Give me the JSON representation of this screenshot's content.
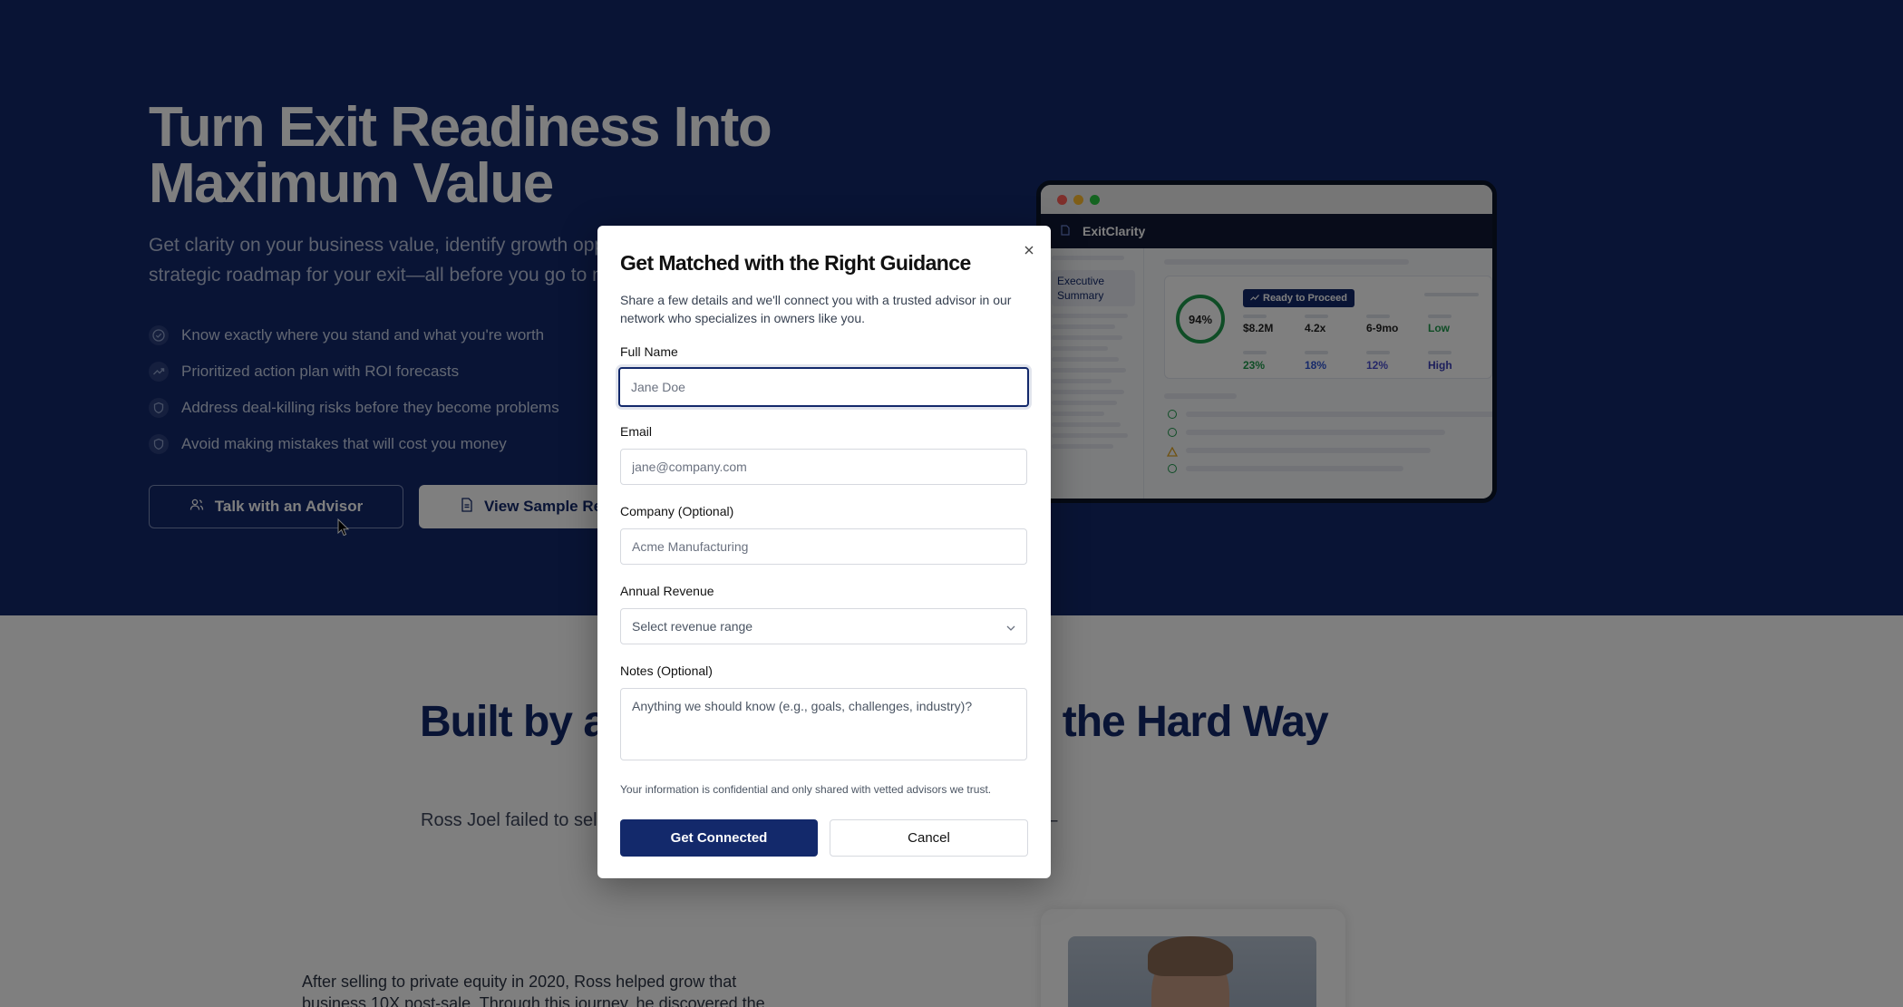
{
  "hero": {
    "title": "Turn Exit Readiness Into Maximum Value",
    "subtitle": "Get clarity on your business value, identify growth opportunities, and get a strategic roadmap for your exit—all before you go to market.",
    "bullets": [
      {
        "icon": "check-circle-icon",
        "text": "Know exactly where you stand and what you're worth"
      },
      {
        "icon": "trending-up-icon",
        "text": "Prioritized action plan with ROI forecasts"
      },
      {
        "icon": "shield-icon",
        "text": "Address deal-killing risks before they become problems"
      },
      {
        "icon": "shield-icon",
        "text": "Avoid making mistakes that will cost you money"
      }
    ],
    "advisor_button": "Talk with an Advisor",
    "sample_button": "View Sample Report"
  },
  "mock_app": {
    "app_name": "ExitClarity",
    "sidebar_active": "Executive Summary",
    "score": "94%",
    "badge": "Ready to Proceed",
    "metrics": {
      "value": "$8.2M",
      "multiple": "4.2x",
      "timeline": "6-9mo",
      "risk": "Low",
      "stat1": "23%",
      "stat2": "18%",
      "stat3": "12%",
      "priority": "High"
    }
  },
  "lower": {
    "title": "Built by an Owner Who Learned the Hard Way",
    "para": "Ross Joel failed to sell his business twice. He learned what derailed his exits —",
    "story": "After selling to private equity in 2020, Ross helped grow that business 10X post-sale. Through this journey, he discovered the"
  },
  "modal": {
    "title": "Get Matched with the Right Guidance",
    "description": "Share a few details and we'll connect you with a trusted advisor in our network who specializes in owners like you.",
    "full_name": {
      "label": "Full Name",
      "placeholder": "Jane Doe",
      "value": ""
    },
    "email": {
      "label": "Email",
      "placeholder": "jane@company.com",
      "value": ""
    },
    "company": {
      "label": "Company (Optional)",
      "placeholder": "Acme Manufacturing",
      "value": ""
    },
    "revenue": {
      "label": "Annual Revenue",
      "selected": "Select revenue range"
    },
    "notes": {
      "label": "Notes (Optional)",
      "placeholder": "Anything we should know (e.g., goals, challenges, industry)?"
    },
    "disclaimer": "Your information is confidential and only shared with vetted advisors we trust.",
    "submit_label": "Get Connected",
    "cancel_label": "Cancel"
  },
  "colors": {
    "brand_navy": "#13296b",
    "success_green": "#1f9a4c",
    "accent_blue": "#2f55d4"
  }
}
